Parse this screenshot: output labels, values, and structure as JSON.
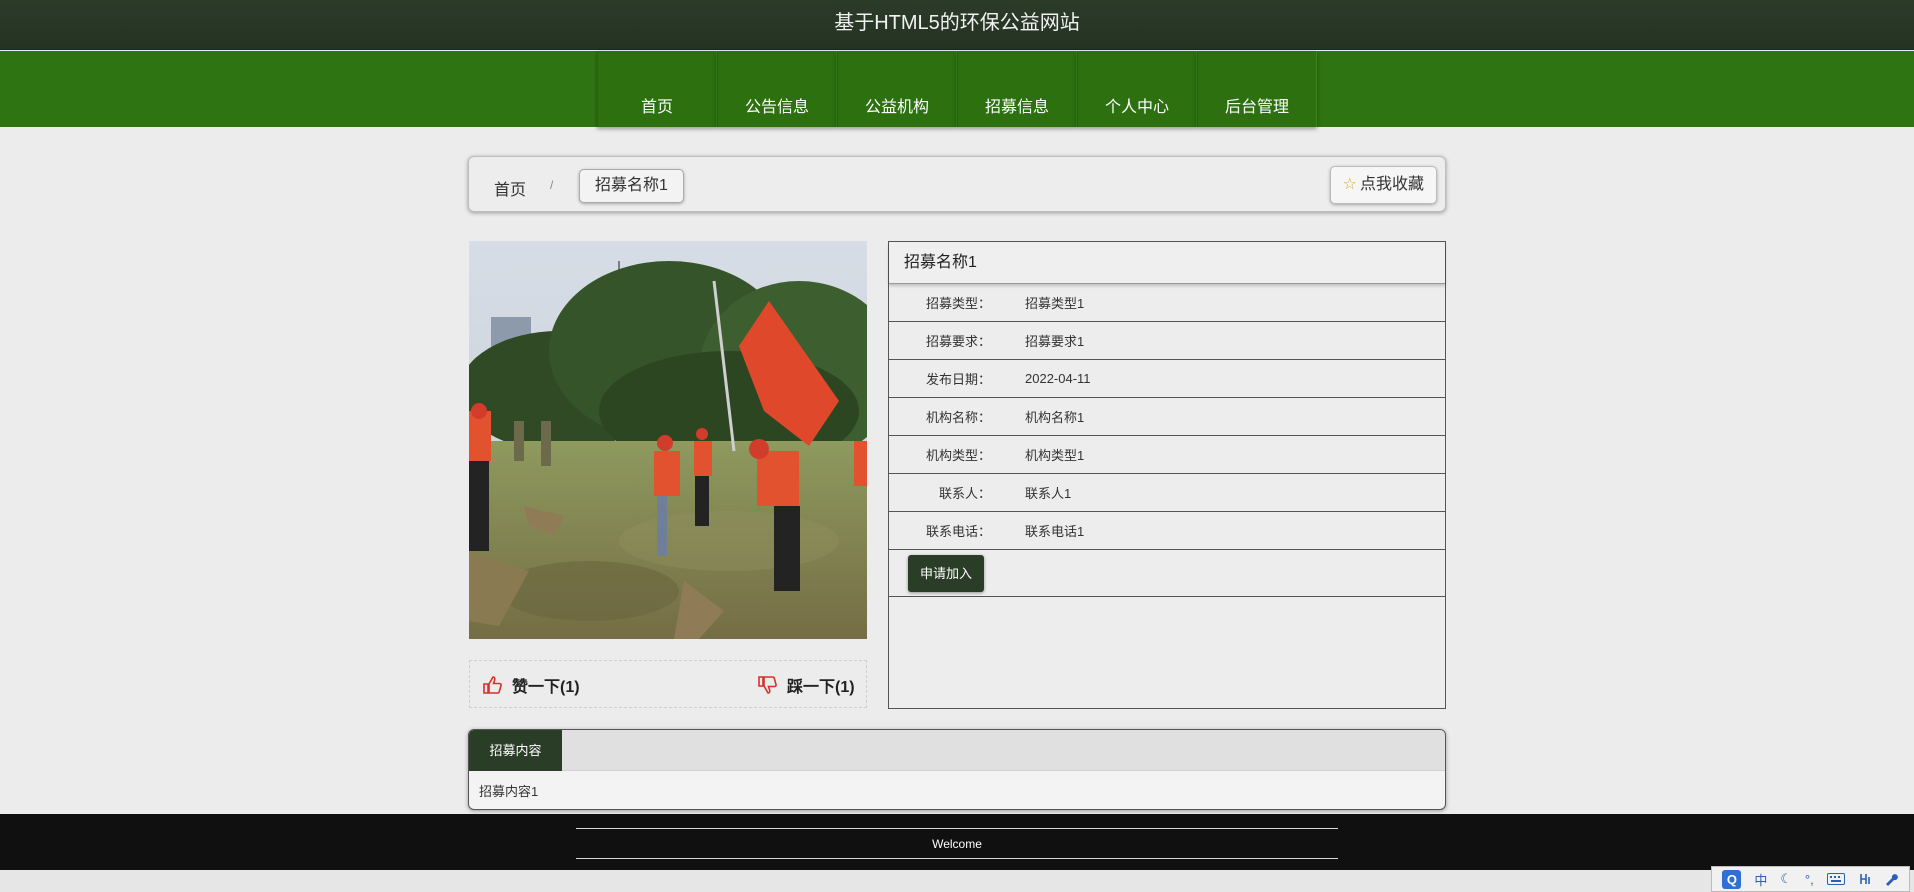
{
  "header": {
    "site_title": "基于HTML5的环保公益网站"
  },
  "nav": {
    "items": [
      {
        "label": "首页"
      },
      {
        "label": "公告信息"
      },
      {
        "label": "公益机构"
      },
      {
        "label": "招募信息"
      },
      {
        "label": "个人中心"
      },
      {
        "label": "后台管理"
      }
    ]
  },
  "breadcrumb": {
    "home": "首页",
    "separator": "/",
    "current": "招募名称1",
    "favorite_label": "点我收藏"
  },
  "votes": {
    "like_label": "赞一下(1)",
    "dislike_label": "踩一下(1)"
  },
  "detail": {
    "title": "招募名称1",
    "rows": [
      {
        "label": "招募类型：",
        "value": "招募类型1"
      },
      {
        "label": "招募要求：",
        "value": "招募要求1"
      },
      {
        "label": "发布日期：",
        "value": "2022-04-11"
      },
      {
        "label": "机构名称：",
        "value": "机构名称1"
      },
      {
        "label": "机构类型：",
        "value": "机构类型1"
      },
      {
        "label": "联系人：",
        "value": "联系人1"
      },
      {
        "label": "联系电话：",
        "value": "联系电话1"
      }
    ],
    "apply_label": "申请加入"
  },
  "content": {
    "tab_label": "招募内容",
    "text": "招募内容1"
  },
  "footer": {
    "text": "Welcome"
  },
  "ime": {
    "logo": "Q",
    "mode": "中",
    "punct": "°,"
  },
  "colors": {
    "header": "#263624",
    "nav": "#2f7413",
    "accent_dark": "#2a3d27",
    "footer": "#101010"
  }
}
